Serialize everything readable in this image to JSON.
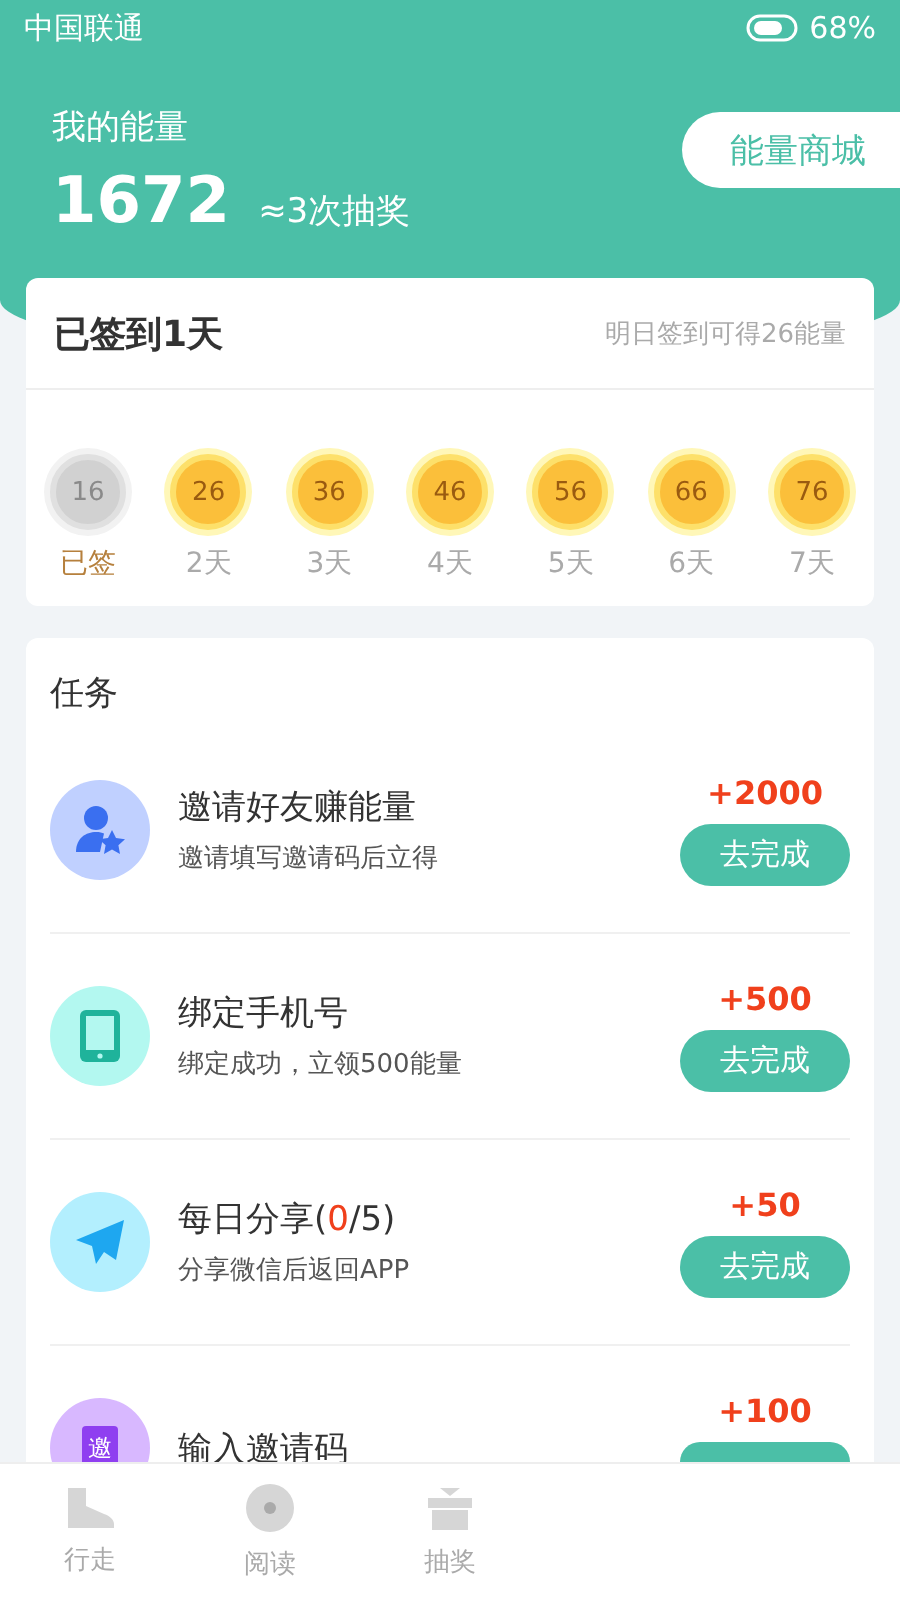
{
  "status_bar": {
    "carrier": "中国联通",
    "battery": "68%"
  },
  "energy": {
    "label": "我的能量",
    "value": "1672",
    "note": "≈3次抽奖",
    "shop_button": "能量商城"
  },
  "signin": {
    "title": "已签到1天",
    "hint": "明日签到可得26能量",
    "days": [
      {
        "value": "16",
        "label": "已签",
        "signed": true
      },
      {
        "value": "26",
        "label": "2天",
        "signed": false
      },
      {
        "value": "36",
        "label": "3天",
        "signed": false
      },
      {
        "value": "46",
        "label": "4天",
        "signed": false
      },
      {
        "value": "56",
        "label": "5天",
        "signed": false
      },
      {
        "value": "66",
        "label": "6天",
        "signed": false
      },
      {
        "value": "76",
        "label": "7天",
        "signed": false
      }
    ]
  },
  "tasks": {
    "title": "任务",
    "items": [
      {
        "kind": "invite",
        "title": "邀请好友赚能量",
        "subtitle": "邀请填写邀请码后立得",
        "reward": "+2000",
        "button": "去完成"
      },
      {
        "kind": "phone",
        "title": "绑定手机号",
        "subtitle": "绑定成功，立领500能量",
        "reward": "+500",
        "button": "去完成"
      },
      {
        "kind": "share",
        "title": "每日分享(",
        "highlight": "0",
        "title_rest": "/5)",
        "subtitle": "分享微信后返回APP",
        "reward": "+50",
        "button": "去完成"
      },
      {
        "kind": "code",
        "icon_text": "邀",
        "title": "输入邀请码",
        "reward": "+100"
      }
    ]
  },
  "tab_bar": [
    {
      "kind": "walk",
      "label": "行走",
      "selected": false
    },
    {
      "kind": "read",
      "label": "阅读",
      "selected": false
    },
    {
      "kind": "gift",
      "label": "抽奖",
      "selected": false
    }
  ]
}
